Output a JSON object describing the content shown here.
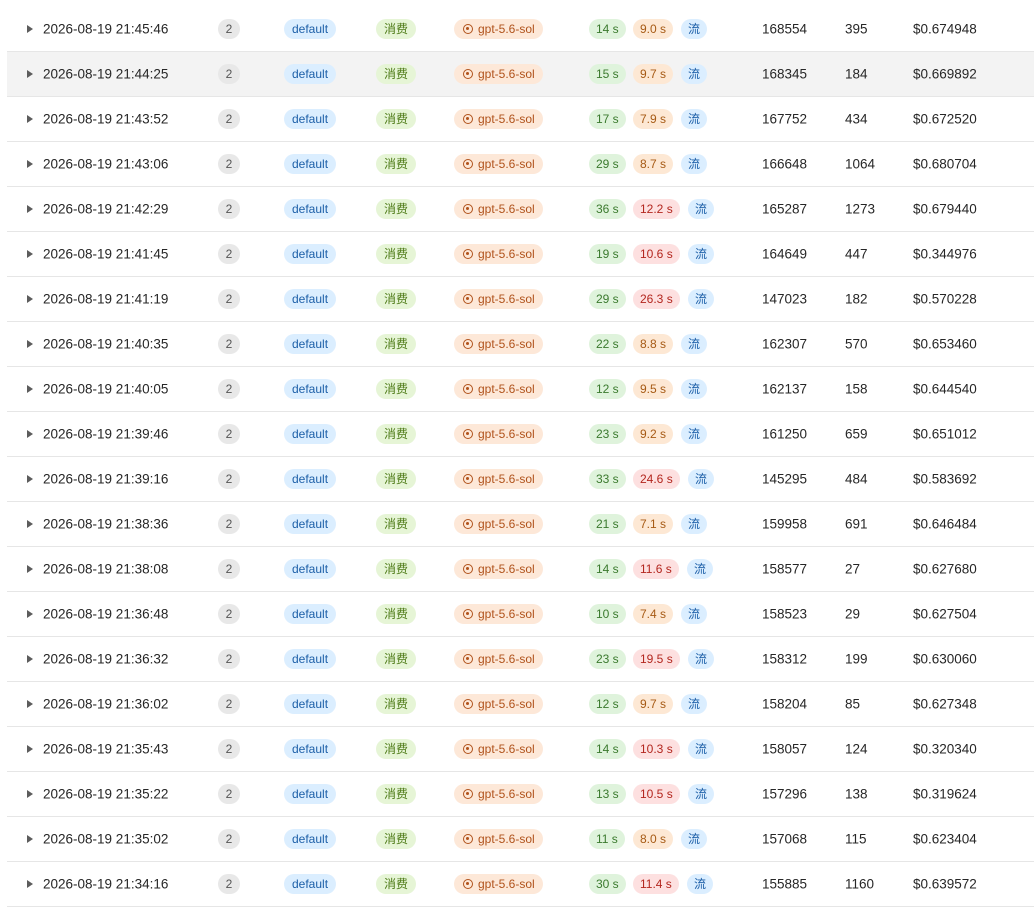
{
  "table": {
    "rows": [
      {
        "time": "2026-08-19 21:45:46",
        "count": "2",
        "group": "default",
        "type": "消费",
        "model": "gpt-5.6-sol",
        "duration": "14 s",
        "first_token": "9.0 s",
        "ft_level": "warn",
        "stream": "流",
        "input_tokens": "168554",
        "output_tokens": "395",
        "cost": "$0.674948"
      },
      {
        "time": "2026-08-19 21:44:25",
        "count": "2",
        "group": "default",
        "type": "消费",
        "model": "gpt-5.6-sol",
        "duration": "15 s",
        "first_token": "9.7 s",
        "ft_level": "warn",
        "stream": "流",
        "input_tokens": "168345",
        "output_tokens": "184",
        "cost": "$0.669892"
      },
      {
        "time": "2026-08-19 21:43:52",
        "count": "2",
        "group": "default",
        "type": "消费",
        "model": "gpt-5.6-sol",
        "duration": "17 s",
        "first_token": "7.9 s",
        "ft_level": "warn",
        "stream": "流",
        "input_tokens": "167752",
        "output_tokens": "434",
        "cost": "$0.672520"
      },
      {
        "time": "2026-08-19 21:43:06",
        "count": "2",
        "group": "default",
        "type": "消费",
        "model": "gpt-5.6-sol",
        "duration": "29 s",
        "first_token": "8.7 s",
        "ft_level": "warn",
        "stream": "流",
        "input_tokens": "166648",
        "output_tokens": "1064",
        "cost": "$0.680704"
      },
      {
        "time": "2026-08-19 21:42:29",
        "count": "2",
        "group": "default",
        "type": "消费",
        "model": "gpt-5.6-sol",
        "duration": "36 s",
        "first_token": "12.2 s",
        "ft_level": "bad",
        "stream": "流",
        "input_tokens": "165287",
        "output_tokens": "1273",
        "cost": "$0.679440"
      },
      {
        "time": "2026-08-19 21:41:45",
        "count": "2",
        "group": "default",
        "type": "消费",
        "model": "gpt-5.6-sol",
        "duration": "19 s",
        "first_token": "10.6 s",
        "ft_level": "bad",
        "stream": "流",
        "input_tokens": "164649",
        "output_tokens": "447",
        "cost": "$0.344976"
      },
      {
        "time": "2026-08-19 21:41:19",
        "count": "2",
        "group": "default",
        "type": "消费",
        "model": "gpt-5.6-sol",
        "duration": "29 s",
        "first_token": "26.3 s",
        "ft_level": "bad",
        "stream": "流",
        "input_tokens": "147023",
        "output_tokens": "182",
        "cost": "$0.570228"
      },
      {
        "time": "2026-08-19 21:40:35",
        "count": "2",
        "group": "default",
        "type": "消费",
        "model": "gpt-5.6-sol",
        "duration": "22 s",
        "first_token": "8.8 s",
        "ft_level": "warn",
        "stream": "流",
        "input_tokens": "162307",
        "output_tokens": "570",
        "cost": "$0.653460"
      },
      {
        "time": "2026-08-19 21:40:05",
        "count": "2",
        "group": "default",
        "type": "消费",
        "model": "gpt-5.6-sol",
        "duration": "12 s",
        "first_token": "9.5 s",
        "ft_level": "warn",
        "stream": "流",
        "input_tokens": "162137",
        "output_tokens": "158",
        "cost": "$0.644540"
      },
      {
        "time": "2026-08-19 21:39:46",
        "count": "2",
        "group": "default",
        "type": "消费",
        "model": "gpt-5.6-sol",
        "duration": "23 s",
        "first_token": "9.2 s",
        "ft_level": "warn",
        "stream": "流",
        "input_tokens": "161250",
        "output_tokens": "659",
        "cost": "$0.651012"
      },
      {
        "time": "2026-08-19 21:39:16",
        "count": "2",
        "group": "default",
        "type": "消费",
        "model": "gpt-5.6-sol",
        "duration": "33 s",
        "first_token": "24.6 s",
        "ft_level": "bad",
        "stream": "流",
        "input_tokens": "145295",
        "output_tokens": "484",
        "cost": "$0.583692"
      },
      {
        "time": "2026-08-19 21:38:36",
        "count": "2",
        "group": "default",
        "type": "消费",
        "model": "gpt-5.6-sol",
        "duration": "21 s",
        "first_token": "7.1 s",
        "ft_level": "warn",
        "stream": "流",
        "input_tokens": "159958",
        "output_tokens": "691",
        "cost": "$0.646484"
      },
      {
        "time": "2026-08-19 21:38:08",
        "count": "2",
        "group": "default",
        "type": "消费",
        "model": "gpt-5.6-sol",
        "duration": "14 s",
        "first_token": "11.6 s",
        "ft_level": "bad",
        "stream": "流",
        "input_tokens": "158577",
        "output_tokens": "27",
        "cost": "$0.627680"
      },
      {
        "time": "2026-08-19 21:36:48",
        "count": "2",
        "group": "default",
        "type": "消费",
        "model": "gpt-5.6-sol",
        "duration": "10 s",
        "first_token": "7.4 s",
        "ft_level": "warn",
        "stream": "流",
        "input_tokens": "158523",
        "output_tokens": "29",
        "cost": "$0.627504"
      },
      {
        "time": "2026-08-19 21:36:32",
        "count": "2",
        "group": "default",
        "type": "消费",
        "model": "gpt-5.6-sol",
        "duration": "23 s",
        "first_token": "19.5 s",
        "ft_level": "bad",
        "stream": "流",
        "input_tokens": "158312",
        "output_tokens": "199",
        "cost": "$0.630060"
      },
      {
        "time": "2026-08-19 21:36:02",
        "count": "2",
        "group": "default",
        "type": "消费",
        "model": "gpt-5.6-sol",
        "duration": "12 s",
        "first_token": "9.7 s",
        "ft_level": "warn",
        "stream": "流",
        "input_tokens": "158204",
        "output_tokens": "85",
        "cost": "$0.627348"
      },
      {
        "time": "2026-08-19 21:35:43",
        "count": "2",
        "group": "default",
        "type": "消费",
        "model": "gpt-5.6-sol",
        "duration": "14 s",
        "first_token": "10.3 s",
        "ft_level": "bad",
        "stream": "流",
        "input_tokens": "158057",
        "output_tokens": "124",
        "cost": "$0.320340"
      },
      {
        "time": "2026-08-19 21:35:22",
        "count": "2",
        "group": "default",
        "type": "消费",
        "model": "gpt-5.6-sol",
        "duration": "13 s",
        "first_token": "10.5 s",
        "ft_level": "bad",
        "stream": "流",
        "input_tokens": "157296",
        "output_tokens": "138",
        "cost": "$0.319624"
      },
      {
        "time": "2026-08-19 21:35:02",
        "count": "2",
        "group": "default",
        "type": "消费",
        "model": "gpt-5.6-sol",
        "duration": "11 s",
        "first_token": "8.0 s",
        "ft_level": "warn",
        "stream": "流",
        "input_tokens": "157068",
        "output_tokens": "115",
        "cost": "$0.623404"
      },
      {
        "time": "2026-08-19 21:34:16",
        "count": "2",
        "group": "default",
        "type": "消费",
        "model": "gpt-5.6-sol",
        "duration": "30 s",
        "first_token": "11.4 s",
        "ft_level": "bad",
        "stream": "流",
        "input_tokens": "155885",
        "output_tokens": "1160",
        "cost": "$0.639572"
      }
    ],
    "hover_row_index": 1,
    "colors": {
      "group_bg": "#dbeeff",
      "type_bg": "#e6f5d6",
      "model_bg": "#fde8d8",
      "duration_bg": "#dff3dc",
      "ft_warn_bg": "#fde8d4",
      "ft_bad_bg": "#fde0e0",
      "stream_bg": "#dbeeff"
    },
    "icons": {
      "expand": "caret-right-icon",
      "model": "openai-icon"
    }
  }
}
